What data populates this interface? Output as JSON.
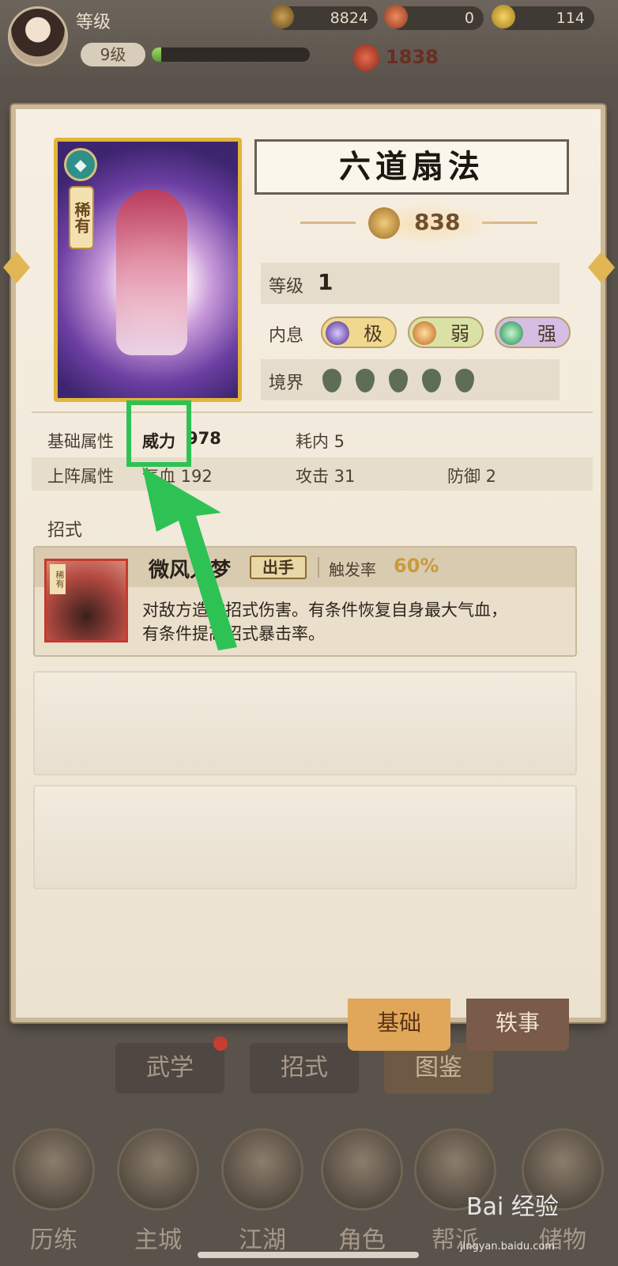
{
  "header": {
    "level_label": "等级",
    "level_pill": "9级",
    "exp_progress": 0.06,
    "currency_copper": "8824",
    "currency_token": "0",
    "currency_gold": "114",
    "power": "1838"
  },
  "panel": {
    "martial_name": "六道扇法",
    "card_rarity": "稀有",
    "power": "838",
    "level_label": "等级",
    "level_value": "1",
    "breath_label": "内息",
    "breath_tags": [
      "极",
      "弱",
      "强"
    ],
    "realm_label": "境界",
    "realm_count": 5,
    "base_attr_label": "基础属性",
    "base_attr_power": "威力",
    "base_attr_power_value": "978",
    "base_attr_cost": "耗内 5",
    "formation_attr_label": "上阵属性",
    "formation_hp": "气血 192",
    "formation_atk": "攻击 31",
    "formation_def": "防御 2",
    "moves_label": "招式",
    "skill": {
      "icon_tag": "稀有",
      "name": "微风入梦",
      "tag": "出手",
      "rate_label": "触发率",
      "rate_value": "60%",
      "description": "对敌方造成招式伤害。有条件恢复自身最大气血，有条件提高招式暴击率。"
    },
    "tab_basic": "基础",
    "tab_story": "轶事"
  },
  "background_tabs": [
    "武学",
    "招式",
    "图鉴"
  ],
  "bottom_nav": [
    "历练",
    "主城",
    "江湖",
    "角色",
    "帮派",
    "储物"
  ],
  "watermark": "Bai 经验",
  "watermark_sub": "jingyan.baidu.com",
  "colors": {
    "highlight": "#2ec255",
    "panel_bg": "#f1e9da",
    "accent_gold": "#e0b53a"
  }
}
